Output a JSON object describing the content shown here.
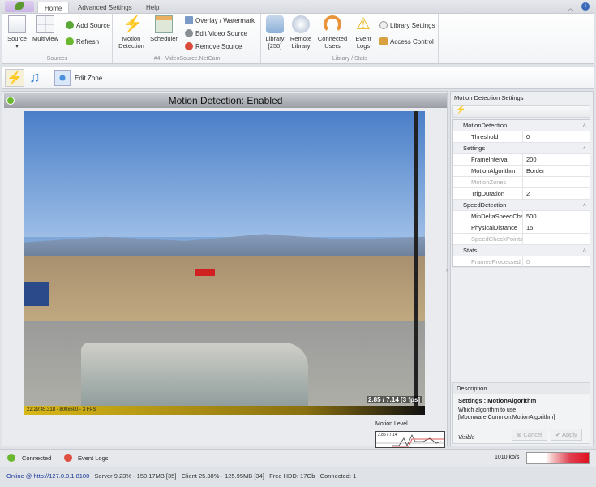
{
  "tabs": {
    "home": "Home",
    "advanced": "Advanced Settings",
    "help": "Help"
  },
  "ribbon": {
    "sources": {
      "source": "Source",
      "multiview": "MultiView",
      "add_source": "Add Source",
      "refresh": "Refresh",
      "label": "Sources"
    },
    "video": {
      "motion": "Motion Detection",
      "scheduler": "Scheduler",
      "overlay": "Overlay / Watermark",
      "edit": "Edit Video Source",
      "remove": "Remove Source",
      "label": "#4 - VideoSource.NetCam"
    },
    "library": {
      "library": "Library [250]",
      "remote": "Remote Library",
      "users": "Connected Users",
      "logs": "Event Logs",
      "settings": "Library Settings",
      "access": "Access Control",
      "label": "Library / Stats"
    }
  },
  "quickbar": {
    "edit_zone": "Edit Zone"
  },
  "video": {
    "header": "Motion Detection: Enabled",
    "footer": "22:29:45.318 - 800x600 - 3 FPS",
    "overlay": "2.85 / 7.14 [3 fps]",
    "motion_level_label": "Motion Level",
    "motion_level_value": "2.85 / 7.14"
  },
  "panel": {
    "title": "Motion Detection Settings",
    "grid": [
      {
        "type": "cat",
        "label": "MotionDetection"
      },
      {
        "type": "prop",
        "key": "Threshold",
        "value": "0"
      },
      {
        "type": "cat",
        "label": "Settings"
      },
      {
        "type": "prop",
        "key": "FrameInterval",
        "value": "200"
      },
      {
        "type": "prop",
        "key": "MotionAlgorithm",
        "value": "Border"
      },
      {
        "type": "dis",
        "key": "MotionZones",
        "value": ""
      },
      {
        "type": "prop",
        "key": "TrigDuration",
        "value": "2"
      },
      {
        "type": "cat",
        "label": "SpeedDetection"
      },
      {
        "type": "prop",
        "key": "MinDeltaSpeedCheck",
        "value": "500"
      },
      {
        "type": "prop",
        "key": "PhysicalDistance",
        "value": "15"
      },
      {
        "type": "dis",
        "key": "SpeedCheckPoints",
        "value": ""
      },
      {
        "type": "cat",
        "label": "Stats"
      },
      {
        "type": "dis",
        "key": "FramesProcessed",
        "value": "0"
      }
    ],
    "desc_heading": "Description",
    "desc_title": "Settings : MotionAlgorithm",
    "desc_text": "Which algorithm to use [Moonware.Common.MotionAlgorithm]",
    "visible": "Visible",
    "cancel": "Cancel",
    "apply": "Apply"
  },
  "status": {
    "connected": "Connected",
    "event_logs": "Event Logs",
    "bandwidth": "1010 kb/s"
  },
  "bottom": {
    "online": "Online @ http://127.0.0.1:8100",
    "server": "Server 9.23% - 150.17MB [35]",
    "client": "Client 25.38% - 125.95MB [34]",
    "hdd": "Free HDD: 17Gb",
    "connected": "Connected: 1"
  },
  "colors": {
    "connected": "#6ab82e",
    "event": "#e05040",
    "link": "#1a3a9a"
  }
}
